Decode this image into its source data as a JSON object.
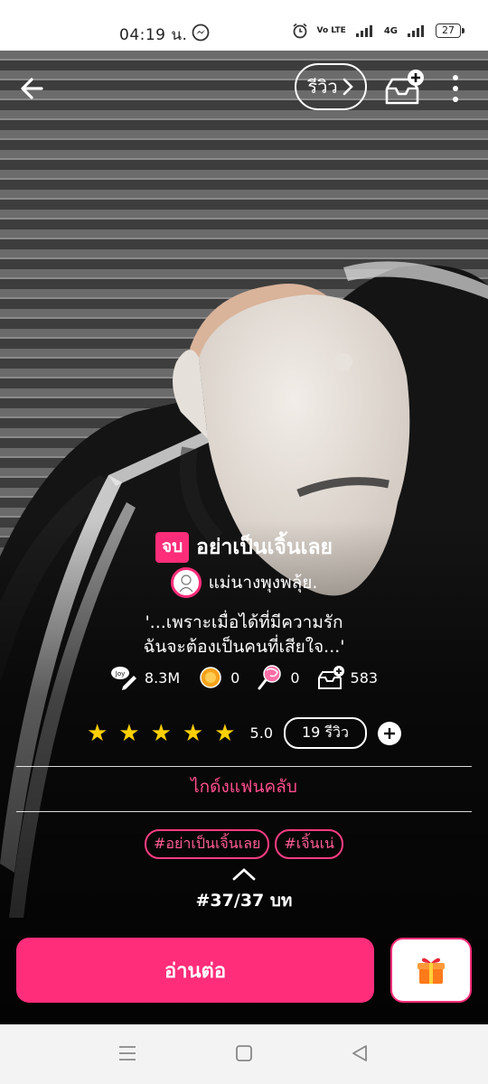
{
  "status_bar": {
    "time": "04:19 น.",
    "volte": "Vo LTE",
    "network": "4G",
    "battery": "27"
  },
  "header": {
    "review_button_label": "รีวิว"
  },
  "story": {
    "status_badge": "จบ",
    "title": "อย่าเป็นเจิ้นเลย",
    "author": "แม่นางพุงพลุ้ย.",
    "quote_line1": "'...เพราะเมื่อได้ที่มีความรัก",
    "quote_line2": "ฉันจะต้องเป็นคนที่เสียใจ...'"
  },
  "stats": {
    "views": "8.3M",
    "coins": "0",
    "candy": "0",
    "library": "583"
  },
  "rating": {
    "stars": 5,
    "value": "5.0",
    "reviews_label": "19 รีวิว"
  },
  "fanclub_label": "ไกด์งแฟนคลับ",
  "tags": [
    "#อย่าเป็นเจิ้นเลย",
    "#เจิ้นเน่"
  ],
  "chapter_label": "#37/37 บท",
  "read_button_label": "อ่านต่อ",
  "colors": {
    "accent": "#ff2d7a",
    "star": "#ffd000"
  }
}
